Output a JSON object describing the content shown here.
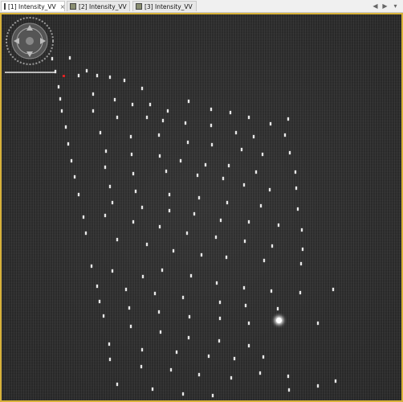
{
  "tabs": [
    {
      "label": "[1] Intensity_VV",
      "active": true
    },
    {
      "label": "[2] Intensity_VV",
      "active": false
    },
    {
      "label": "[3] Intensity_VV",
      "active": false
    }
  ],
  "tab_close_glyph": "×",
  "nav": {
    "left": "◀",
    "right": "▶",
    "menu": "▾"
  },
  "image": {
    "description_color": "#2a2a2a",
    "border_color": "#d8b23a"
  },
  "icons": [
    "image-icon",
    "close-icon",
    "navigation-wheel-icon"
  ]
}
